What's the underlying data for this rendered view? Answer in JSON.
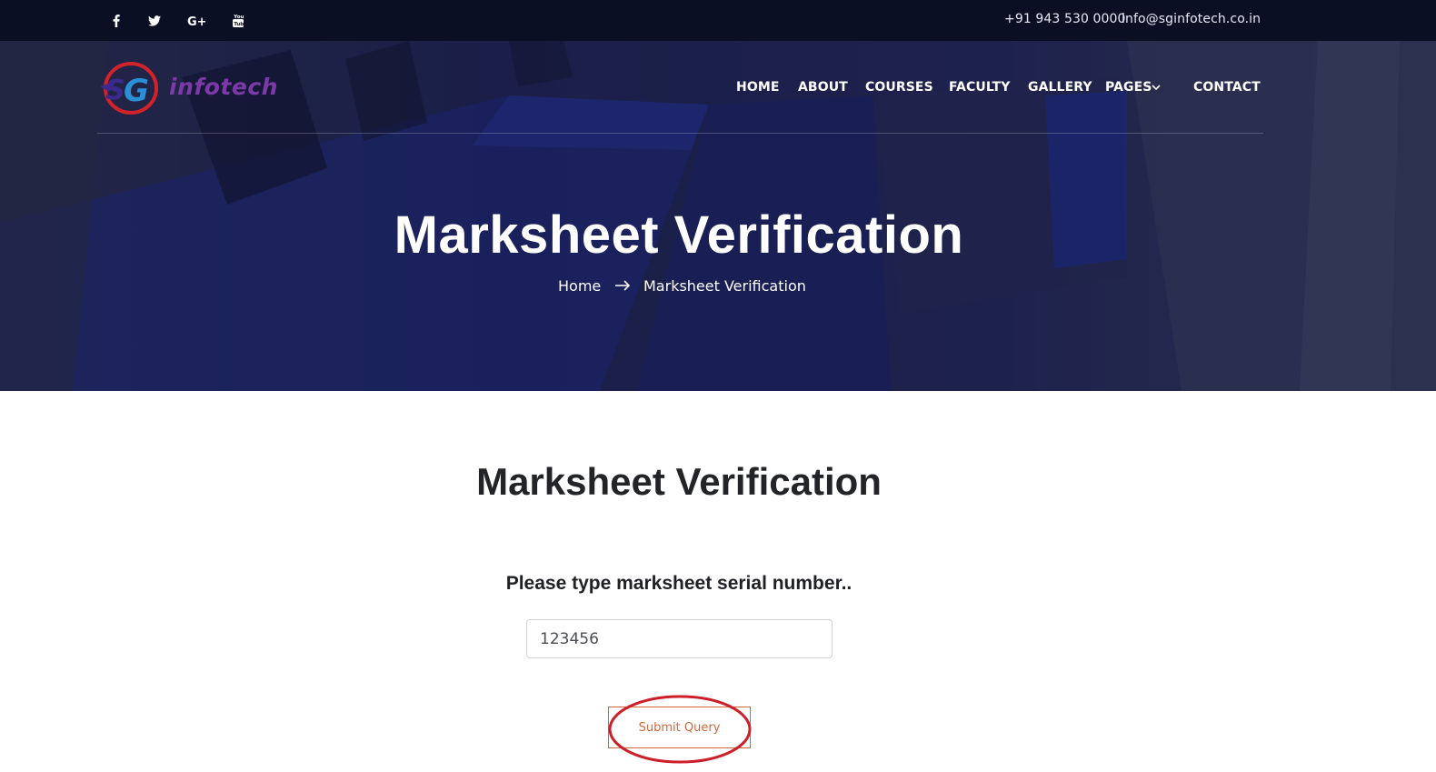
{
  "topbar": {
    "social": [
      {
        "icon": "facebook-icon"
      },
      {
        "icon": "twitter-icon"
      },
      {
        "icon": "google-plus-icon"
      },
      {
        "icon": "youtube-icon"
      }
    ],
    "phone": "+91 943 530 0000",
    "email": "info@sginfotech.co.in"
  },
  "header": {
    "logo_text": "infotech",
    "nav": [
      "HOME",
      "ABOUT",
      "COURSES",
      "FACULTY",
      "GALLERY",
      "PAGES",
      "CONTACT"
    ]
  },
  "hero": {
    "title": "Marksheet Verification",
    "breadcrumb": {
      "home": "Home",
      "current": "Marksheet Verification"
    }
  },
  "main": {
    "title": "Marksheet Verification",
    "prompt": "Please type marksheet serial number..",
    "serial_value": "123456",
    "submit_label": "Submit Query"
  },
  "colors": {
    "topbar_bg": "#0b0f24",
    "hero_overlay": "#1b214d",
    "accent": "#d0683a",
    "annotation": "#cc1f2a"
  }
}
